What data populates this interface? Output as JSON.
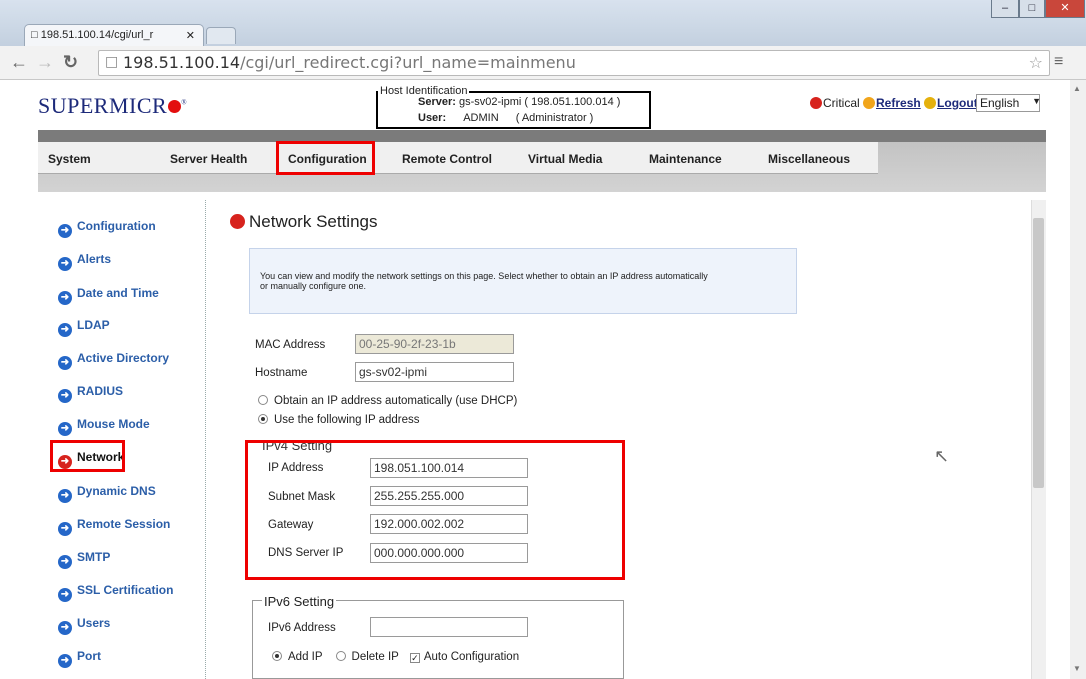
{
  "browser": {
    "tab_title": "198.51.100.14/cgi/url_r",
    "url_host": "198.51.100.14",
    "url_path": "/cgi/url_redirect.cgi?url_name=mainmenu"
  },
  "header": {
    "logo": "SUPERMICR",
    "host_label": "Host Identification",
    "server_label": "Server:",
    "server_value": "gs-sv02-ipmi",
    "server_ip": "( 198.051.100.014 )",
    "user_label": "User:",
    "user_value": "ADMIN",
    "user_role": "( Administrator )",
    "critical": "Critical",
    "refresh": "Refresh",
    "logout": "Logout",
    "language": "English"
  },
  "menu": [
    "System",
    "Server Health",
    "Configuration",
    "Remote Control",
    "Virtual Media",
    "Maintenance",
    "Miscellaneous"
  ],
  "sidebar": [
    "Configuration",
    "Alerts",
    "Date and Time",
    "LDAP",
    "Active Directory",
    "RADIUS",
    "Mouse Mode",
    "Network",
    "Dynamic DNS",
    "Remote Session",
    "SMTP",
    "SSL Certification",
    "Users",
    "Port"
  ],
  "content": {
    "title": "Network Settings",
    "info_line1": "You can view and modify the network settings on this page. Select whether to obtain an IP address automatically",
    "info_line2": "or manually configure one.",
    "mac_label": "MAC Address",
    "mac_value": "00-25-90-2f-23-1b",
    "hostname_label": "Hostname",
    "hostname_value": "gs-sv02-ipmi",
    "dhcp_label": "Obtain an IP address automatically (use DHCP)",
    "static_label": "Use the following IP address",
    "ipv4_legend": "IPv4 Setting",
    "ip_label": "IP Address",
    "ip_value": "198.051.100.014",
    "mask_label": "Subnet Mask",
    "mask_value": "255.255.255.000",
    "gw_label": "Gateway",
    "gw_value": "192.000.002.002",
    "dns_label": "DNS Server IP",
    "dns_value": "000.000.000.000",
    "ipv6_legend": "IPv6 Setting",
    "ipv6_label": "IPv6 Address",
    "ipv6_value": "",
    "add_ip": "Add IP",
    "delete_ip": "Delete IP",
    "auto_conf": "Auto Configuration"
  },
  "colors": {
    "highlight": "#e00000",
    "link": "#2b5ea8",
    "logo": "#1d2a7a"
  }
}
